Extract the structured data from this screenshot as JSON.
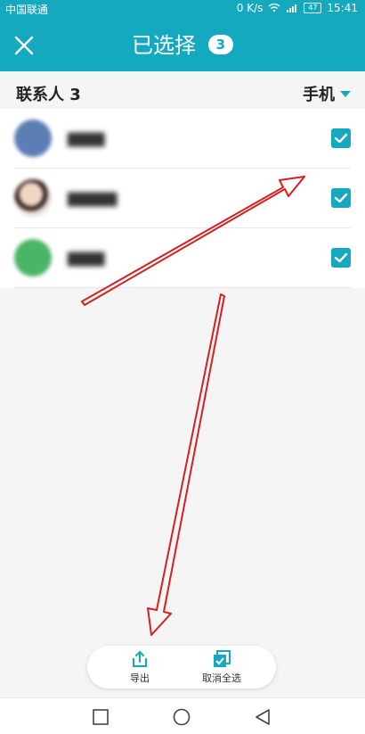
{
  "status_bar": {
    "carrier": "中国联通",
    "speed": "0 K/s",
    "battery": "47",
    "time": "15:41"
  },
  "header": {
    "title": "已选择",
    "count_badge": "3"
  },
  "section": {
    "title": "联系人 3",
    "filter_label": "手机"
  },
  "contacts": [
    {
      "avatar_color": "#5b7fb5"
    },
    {
      "avatar_color": "#c58e74"
    },
    {
      "avatar_color": "#4bb567"
    }
  ],
  "bottom_actions": {
    "export_label": "导出",
    "deselect_all_label": "取消全选"
  },
  "colors": {
    "accent": "#14a9be",
    "annotation_red": "#d32020"
  }
}
